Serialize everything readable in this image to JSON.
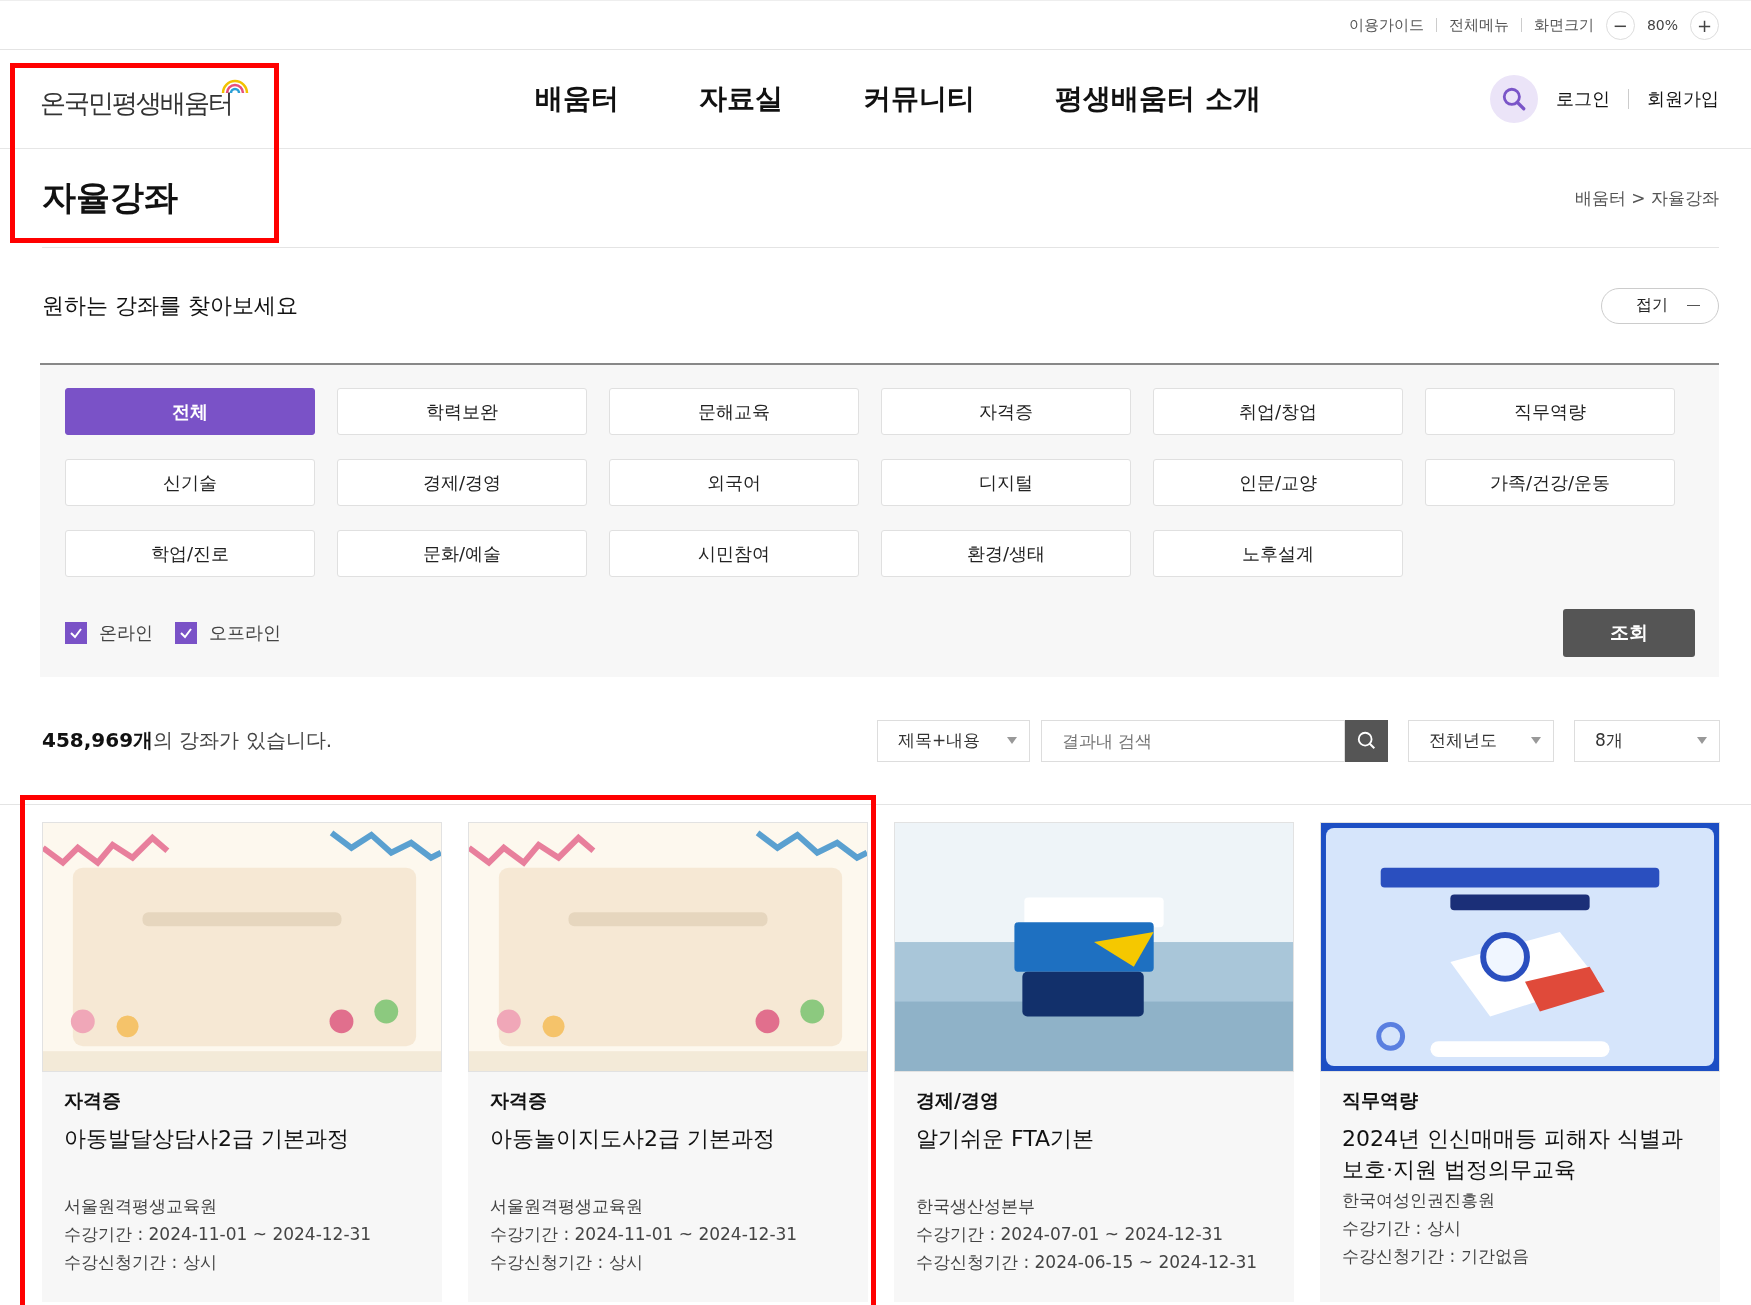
{
  "utility_bar": {
    "links": [
      "이용가이드",
      "전체메뉴",
      "화면크기"
    ],
    "zoom_minus": "−",
    "zoom_value": "80%",
    "zoom_plus": "+"
  },
  "header": {
    "logo": "온국민평생배움터",
    "nav": [
      "배움터",
      "자료실",
      "커뮤니티",
      "평생배움터 소개"
    ],
    "auth_links": [
      "로그인",
      "회원가입"
    ]
  },
  "page": {
    "title": "자율강좌",
    "breadcrumb": "배움터 > 자율강좌"
  },
  "filter": {
    "heading": "원하는 강좌를 찾아보세요",
    "fold_button": "접기",
    "categories": [
      {
        "label": "전체",
        "selected": true
      },
      {
        "label": "학력보완",
        "selected": false
      },
      {
        "label": "문해교육",
        "selected": false
      },
      {
        "label": "자격증",
        "selected": false
      },
      {
        "label": "취업/창업",
        "selected": false
      },
      {
        "label": "직무역량",
        "selected": false
      },
      {
        "label": "신기술",
        "selected": false
      },
      {
        "label": "경제/경영",
        "selected": false
      },
      {
        "label": "외국어",
        "selected": false
      },
      {
        "label": "디지털",
        "selected": false
      },
      {
        "label": "인문/교양",
        "selected": false
      },
      {
        "label": "가족/건강/운동",
        "selected": false
      },
      {
        "label": "학업/진로",
        "selected": false
      },
      {
        "label": "문화/예술",
        "selected": false
      },
      {
        "label": "시민참여",
        "selected": false
      },
      {
        "label": "환경/생태",
        "selected": false
      },
      {
        "label": "노후설계",
        "selected": false
      }
    ],
    "checkboxes": [
      {
        "label": "온라인",
        "checked": true
      },
      {
        "label": "오프라인",
        "checked": true
      }
    ],
    "submit_button": "조회"
  },
  "results": {
    "count": "**458,969개**의 강좌가 있습니다.",
    "search_scope": "제목+내용",
    "search_placeholder": "결과내 검색",
    "year_select": "전체년도",
    "page_size_select": "8개"
  },
  "cards": [
    {
      "category": "자격증",
      "title": "아동발달상담사2급 기본과정",
      "provider": "서울원격평생교육원",
      "period": "수강기간 : 2024-11-01 ~ 2024-12-31",
      "apply_period": "수강신청기간 : 상시"
    },
    {
      "category": "자격증",
      "title": "아동놀이지도사2급 기본과정",
      "provider": "서울원격평생교육원",
      "period": "수강기간 : 2024-11-01 ~ 2024-12-31",
      "apply_period": "수강신청기간 : 상시"
    },
    {
      "category": "경제/경영",
      "title": "알기쉬운 FTA기본",
      "provider": "한국생산성본부",
      "period": "수강기간 : 2024-07-01 ~ 2024-12-31",
      "apply_period": "수강신청기간 : 2024-06-15 ~ 2024-12-31"
    },
    {
      "category": "직무역량",
      "title": "2024년 인신매매등 피해자 식별과 보호·지원 법정의무교육",
      "provider": "한국여성인권진흥원",
      "period": "수강기간 : 상시",
      "apply_period": "수강신청기간 : 기간없음"
    }
  ]
}
